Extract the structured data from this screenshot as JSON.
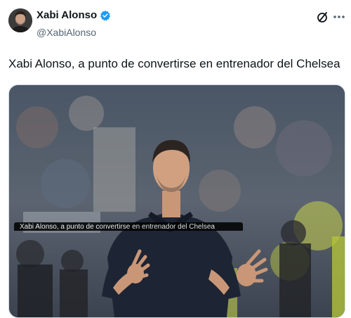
{
  "author": {
    "display_name": "Xabi Alonso",
    "handle": "@XabiAlonso",
    "verified": true,
    "verified_color": "#1d9bf0"
  },
  "actions": {
    "grok_icon": "grok-icon",
    "more_icon": "more-icon"
  },
  "tweet": {
    "text": "Xabi Alonso, a punto de convertirse en entrenador del Chelsea"
  },
  "media": {
    "caption": "Xabi Alonso, a punto de convertirse en entrenador del Chelsea"
  }
}
